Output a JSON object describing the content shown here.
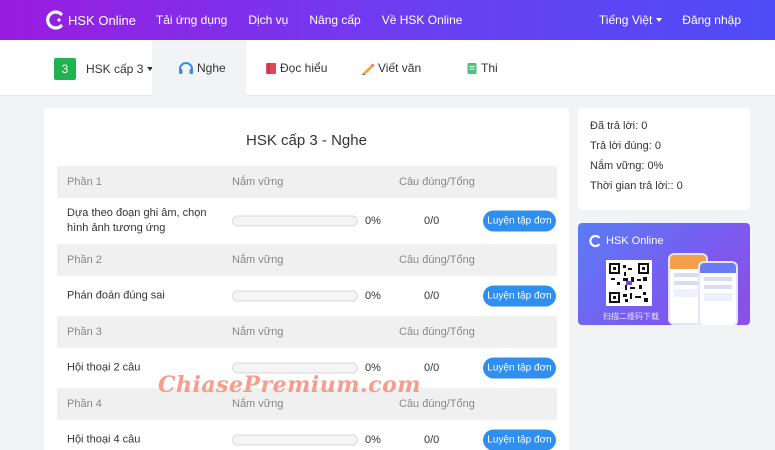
{
  "topnav": {
    "brand": "HSK Online",
    "links": [
      "Tải ứng dụng",
      "Dịch vụ",
      "Nâng cấp",
      "Về HSK Online"
    ],
    "language": "Tiếng Việt",
    "login": "Đăng nhập",
    "gradient_start": "#9a1ce0",
    "gradient_end": "#4e4cf6"
  },
  "subnav": {
    "level_badge": "3",
    "level_label": "HSK cấp 3",
    "tabs": [
      {
        "label": "Nghe",
        "icon": "headphones-icon",
        "active": true
      },
      {
        "label": "Đọc hiểu",
        "icon": "book-icon",
        "active": false
      },
      {
        "label": "Viết văn",
        "icon": "pencil-icon",
        "active": false
      },
      {
        "label": "Thi",
        "icon": "document-icon",
        "active": false
      }
    ]
  },
  "main": {
    "title": "HSK cấp 3 - Nghe",
    "col_mastery": "Nắm vững",
    "col_score": "Câu đúng/Tổng",
    "practice_label": "Luyện tập đơn",
    "sections": [
      {
        "part": "Phần 1",
        "name": "Dựa theo đoạn ghi âm, chọn hình ảnh tương ứng",
        "mastery": "0%",
        "mastery_value": 0,
        "score": "0/0"
      },
      {
        "part": "Phần 2",
        "name": "Phán đoán đúng sai",
        "mastery": "0%",
        "mastery_value": 0,
        "score": "0/0"
      },
      {
        "part": "Phần 3",
        "name": "Hội thoại 2 câu",
        "mastery": "0%",
        "mastery_value": 0,
        "score": "0/0"
      },
      {
        "part": "Phần 4",
        "name": "Hội thoại 4 câu",
        "mastery": "0%",
        "mastery_value": 0,
        "score": "0/0"
      }
    ]
  },
  "stats": {
    "answered": "Đã trả lời: 0",
    "correct": "Trả lời đúng: 0",
    "mastery": "Nắm vững: 0%",
    "time": "Thời gian trả lời:: 0"
  },
  "promo": {
    "brand": "HSK Online",
    "caption": "扫描二维码下载"
  },
  "watermark": "ChiasePremium.com"
}
